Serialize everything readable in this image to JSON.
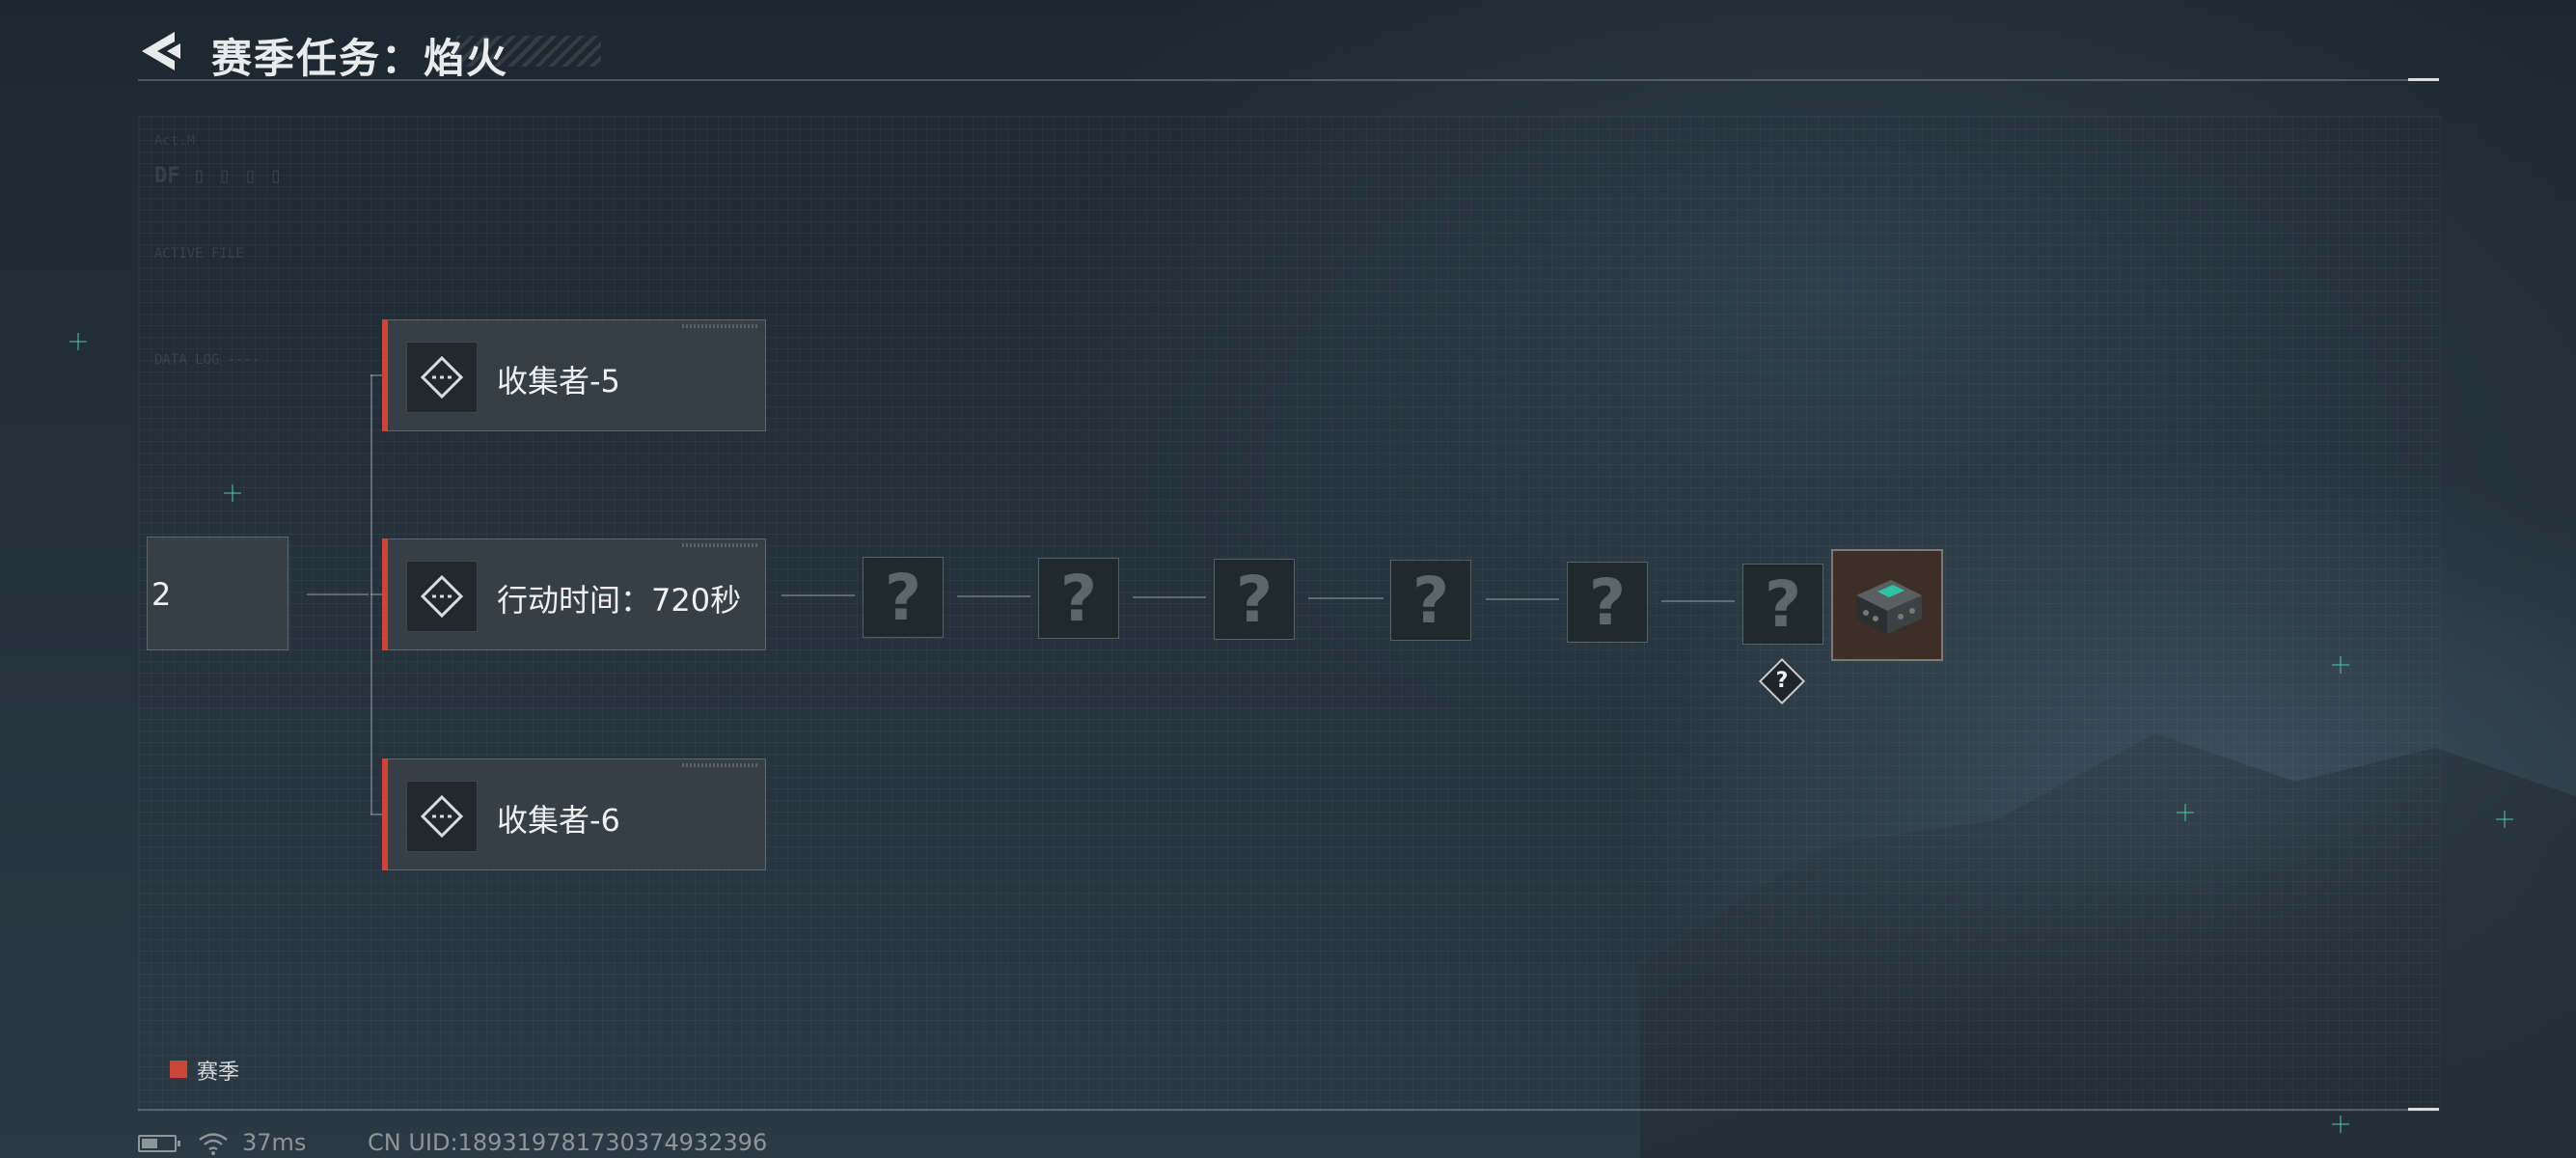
{
  "header": {
    "title": "赛季任务：焰火",
    "back_icon": "back-arrow-icon"
  },
  "task_tree": {
    "previous_node_label": "2",
    "branch_top_label": "收集者-5",
    "branch_middle_label": "行动时间：720秒",
    "branch_bottom_label": "收集者-6",
    "node_icon": "diamond-task-icon",
    "accent_color": "#c8473a",
    "locked_label": "?",
    "locked_count": 6,
    "reward_icon": "device-box-icon",
    "reward_badge": "?"
  },
  "legend": {
    "label": "赛季",
    "color": "#c8473a"
  },
  "status_bar": {
    "battery_icon": "battery-icon",
    "wifi_icon": "wifi-icon",
    "ping": "37ms",
    "uid": "CN UID:1893197817303749323​96"
  }
}
